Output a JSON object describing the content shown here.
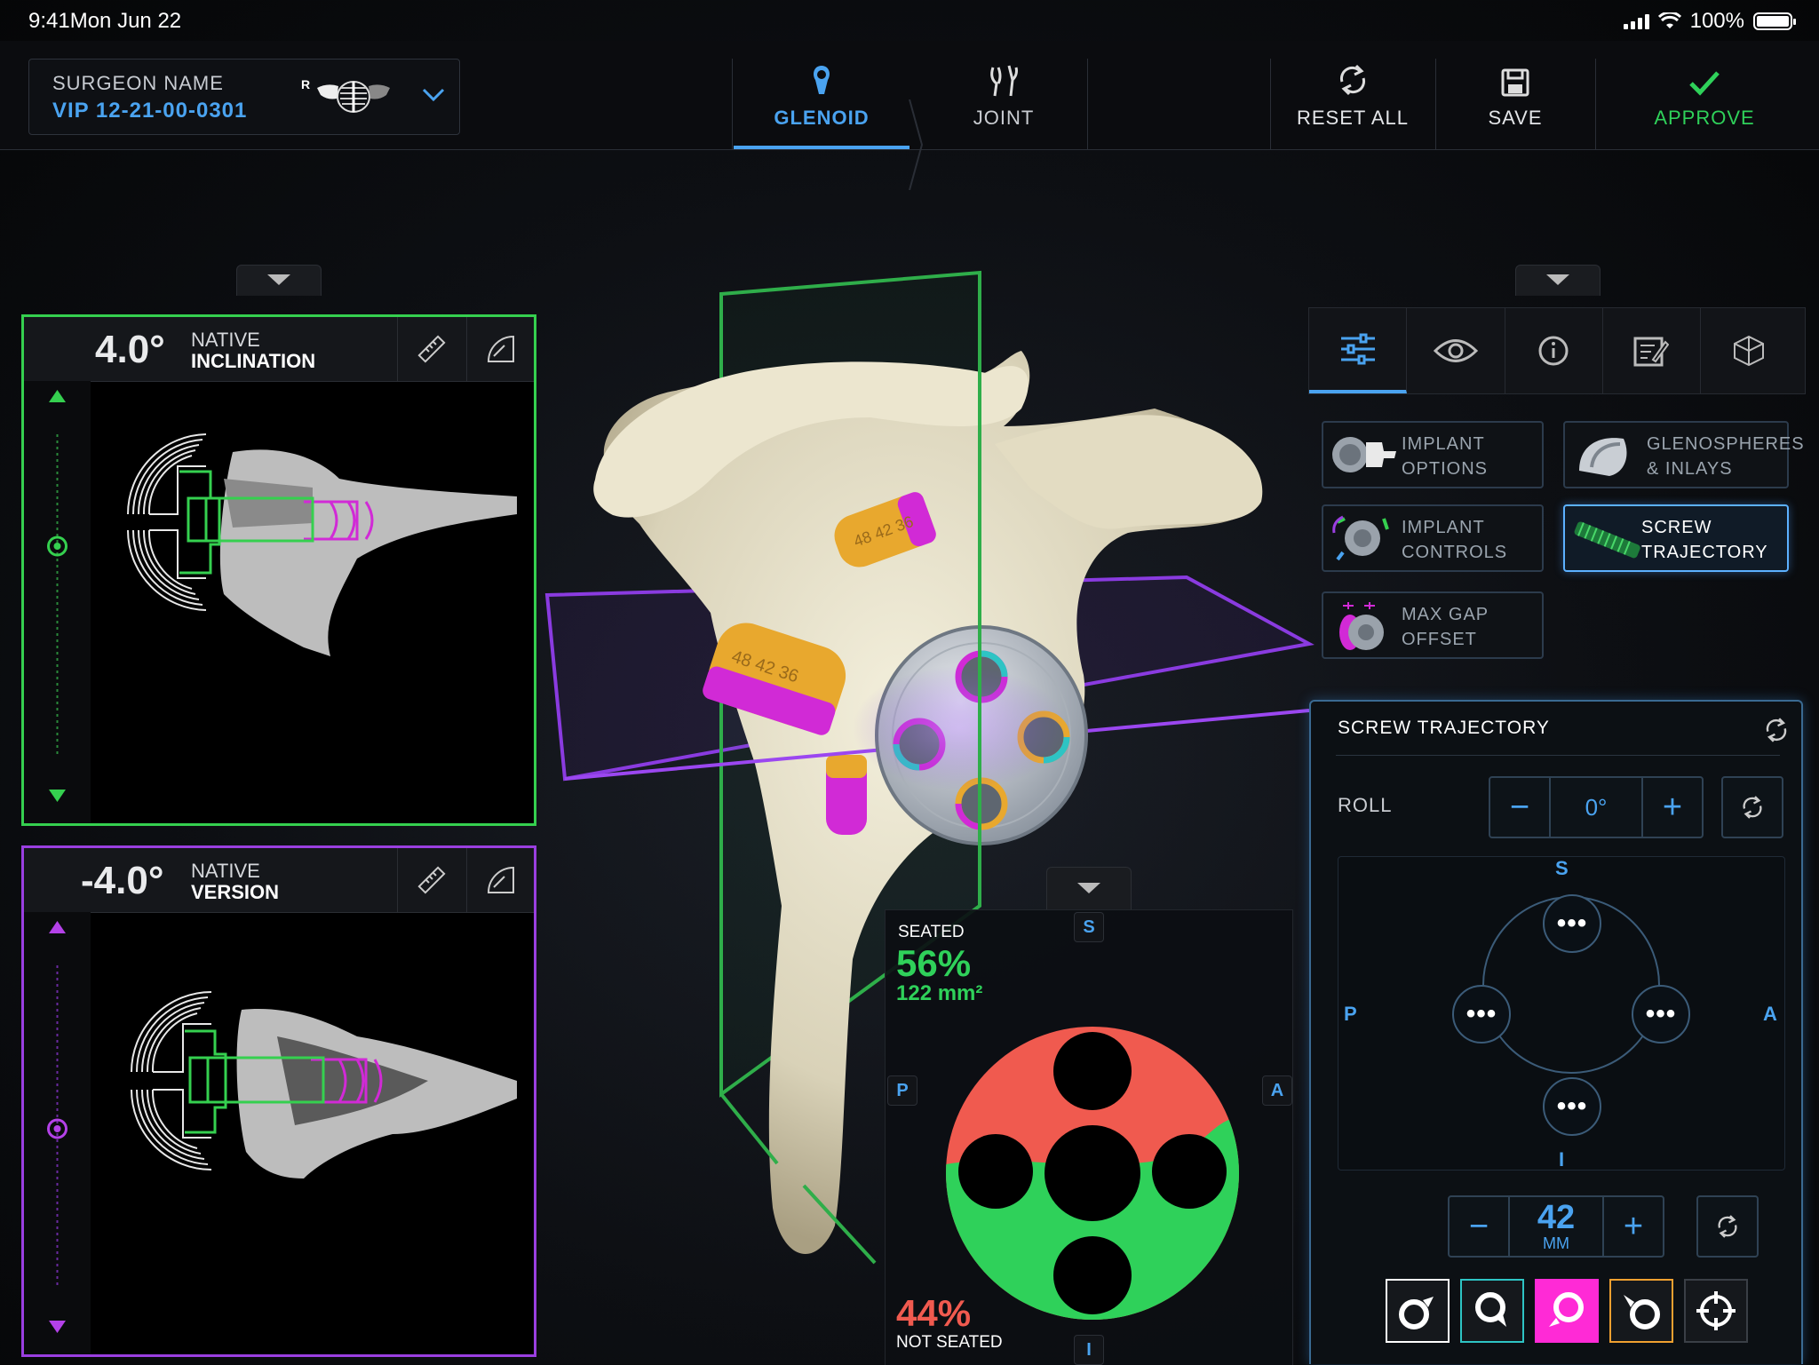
{
  "status_bar": {
    "time": "9:41",
    "date": "Mon Jun 22",
    "battery": "100%"
  },
  "header": {
    "surgeon_label": "SURGEON NAME",
    "case_id": "VIP 12-21-00-0301",
    "side_marker": "R",
    "tabs": [
      {
        "label": "GLENOID",
        "icon": "glenoid-icon",
        "active": true
      },
      {
        "label": "JOINT",
        "icon": "joint-icon",
        "active": false
      }
    ],
    "actions": [
      {
        "label": "RESET ALL",
        "icon": "reset-icon"
      },
      {
        "label": "SAVE",
        "icon": "save-icon"
      },
      {
        "label": "APPROVE",
        "icon": "check-icon",
        "color": "#2fd15a"
      }
    ]
  },
  "inclination_panel": {
    "value": "4.0°",
    "label_top": "NATIVE",
    "label_bottom": "INCLINATION",
    "color": "#35d04f"
  },
  "version_panel": {
    "value": "-4.0°",
    "label_top": "NATIVE",
    "label_bottom": "VERSION",
    "color": "#9a3fe0"
  },
  "right_panel": {
    "toolbar_icons": [
      "sliders-icon",
      "eye-icon",
      "info-icon",
      "notes-icon",
      "cube-icon"
    ],
    "options": [
      {
        "line1": "IMPLANT",
        "line2": "OPTIONS",
        "selected": false
      },
      {
        "line1": "GLENOSPHERES",
        "line2": "& INLAYS",
        "selected": false
      },
      {
        "line1": "IMPLANT",
        "line2": "CONTROLS",
        "selected": false
      },
      {
        "line1": "SCREW",
        "line2": "TRAJECTORY",
        "selected": true
      },
      {
        "line1": "MAX GAP",
        "line2": "OFFSET",
        "selected": false
      }
    ],
    "screw_trajectory": {
      "title": "SCREW TRAJECTORY",
      "roll_label": "ROLL",
      "roll_value": "0°",
      "minus": "−",
      "plus": "+",
      "directions": {
        "s": "S",
        "i": "I",
        "p": "P",
        "a": "A"
      },
      "screw_dots": "•••",
      "length_value": "42",
      "length_unit": "MM",
      "screw_colors": [
        "#ffffff",
        "#2ec4c4",
        "#ff2ad6",
        "#f0a030",
        "#ffffff"
      ]
    }
  },
  "seating": {
    "seated_label": "SEATED",
    "seated_pct": "56%",
    "seated_area": "122 mm²",
    "not_seated_pct": "44%",
    "not_seated_label": "NOT SEATED",
    "seated_fraction": 0.56,
    "directions": {
      "s": "S",
      "i": "I",
      "p": "P",
      "a": "A"
    },
    "seated_color": "#2fd15a",
    "unseated_color": "#f05a4f"
  }
}
